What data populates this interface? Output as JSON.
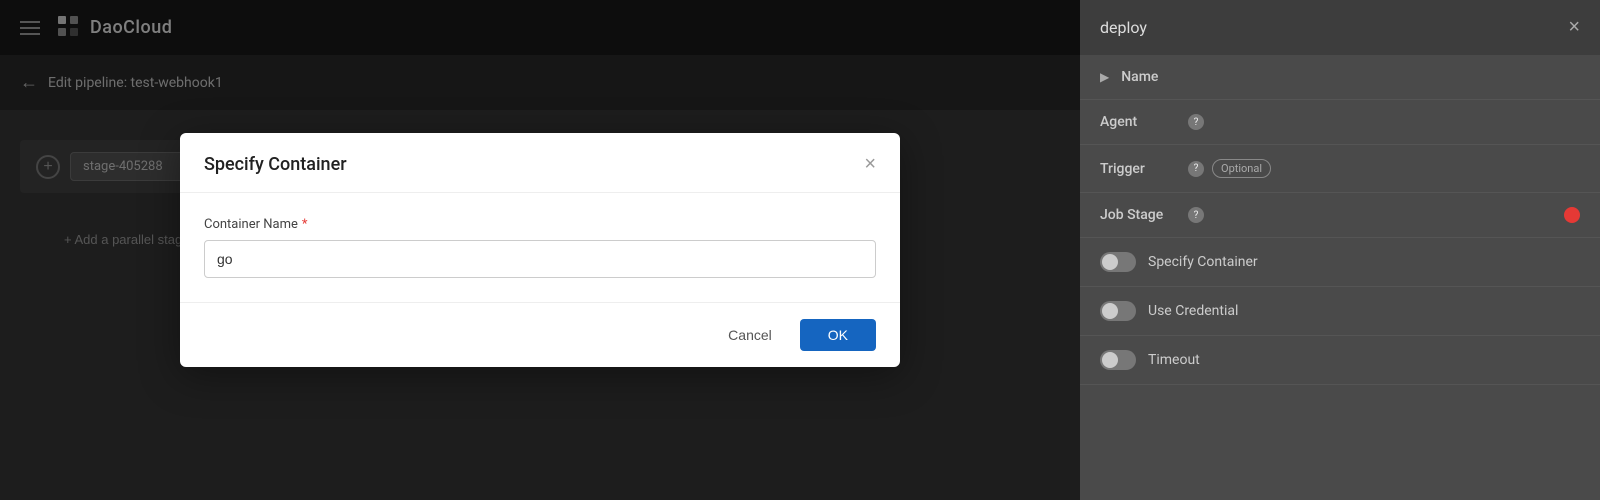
{
  "topNav": {
    "logoText": "DaoCloud",
    "hamburgerLabel": "menu"
  },
  "breadcrumb": {
    "backLabel": "←",
    "text": "Edit pipeline: test-webhook1"
  },
  "canvas": {
    "stagePlusLabel": "+",
    "stageName": "stage-405288",
    "stageArrowLabel": "+",
    "addParallelLabel": "+ Add a parallel stage"
  },
  "rightPanel": {
    "title": "deploy",
    "closeLabel": "×",
    "rows": [
      {
        "label": "Name"
      },
      {
        "label": "Agent",
        "hasHelp": true
      },
      {
        "label": "Trigger",
        "hasHelp": true,
        "badge": "Optional"
      },
      {
        "label": "Job Stage",
        "hasHelp": true,
        "hasError": true
      }
    ],
    "toggles": [
      {
        "label": "Specify Container"
      },
      {
        "label": "Use Credential"
      },
      {
        "label": "Timeout"
      }
    ]
  },
  "modal": {
    "title": "Specify Container",
    "closeLabel": "×",
    "field": {
      "label": "Container Name",
      "required": true,
      "value": "go",
      "placeholder": ""
    },
    "cancelLabel": "Cancel",
    "okLabel": "OK"
  }
}
